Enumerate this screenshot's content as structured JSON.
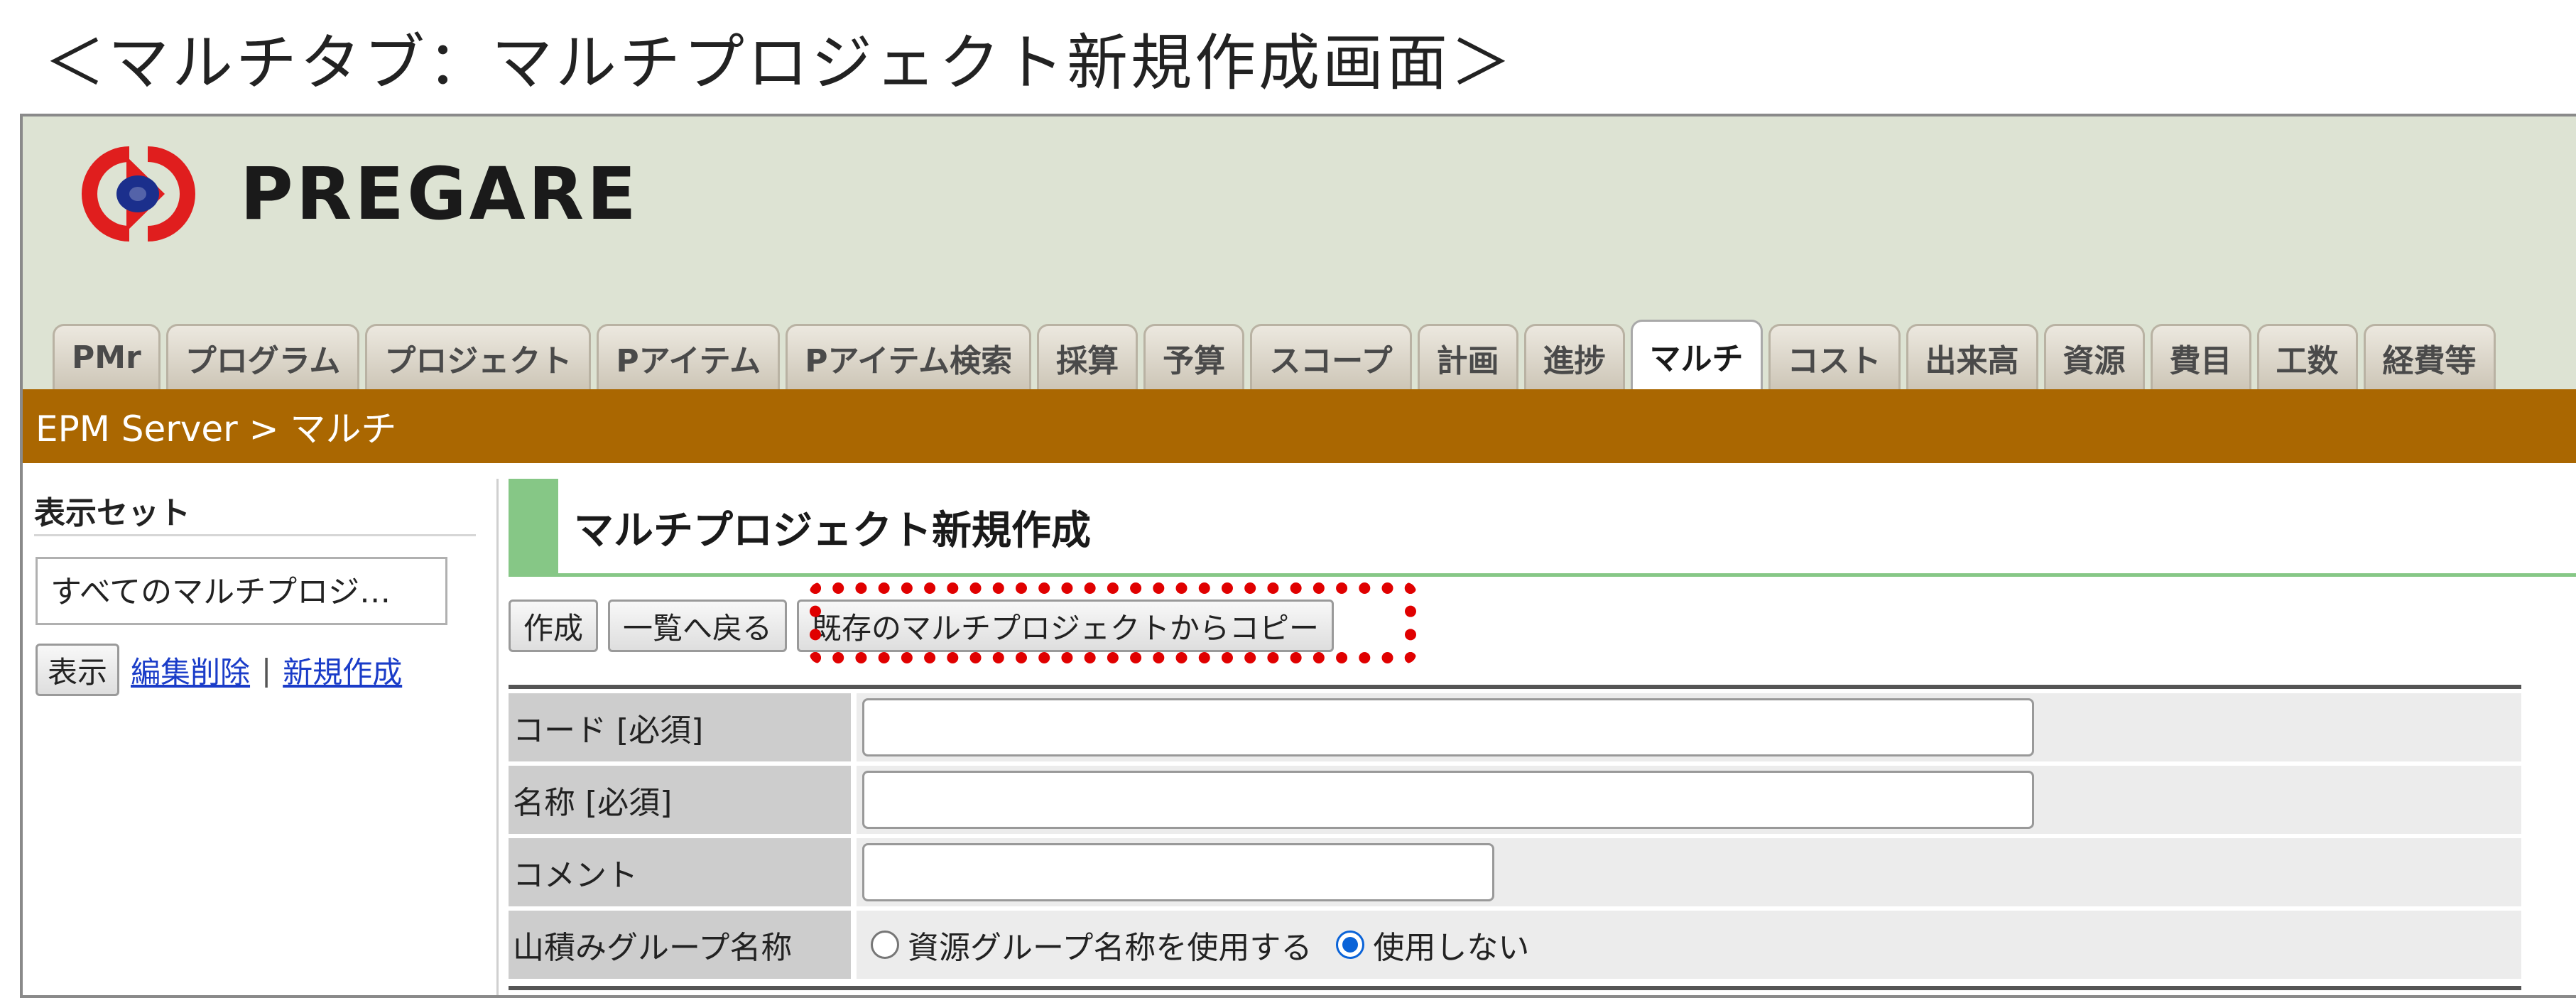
{
  "doc_title": "＜マルチタブ：マルチプロジェクト新規作成画面＞",
  "logo": {
    "text": "PREGARE",
    "icon": "pregare-logo-icon",
    "colors": {
      "red": "#e01e1e",
      "blue": "#1b2f8c"
    }
  },
  "tabs": [
    {
      "label": "PMr",
      "active": false
    },
    {
      "label": "プログラム",
      "active": false
    },
    {
      "label": "プロジェクト",
      "active": false
    },
    {
      "label": "Pアイテム",
      "active": false
    },
    {
      "label": "Pアイテム検索",
      "active": false
    },
    {
      "label": "採算",
      "active": false
    },
    {
      "label": "予算",
      "active": false
    },
    {
      "label": "スコープ",
      "active": false
    },
    {
      "label": "計画",
      "active": false
    },
    {
      "label": "進捗",
      "active": false
    },
    {
      "label": "マルチ",
      "active": true
    },
    {
      "label": "コスト",
      "active": false
    },
    {
      "label": "出来高",
      "active": false
    },
    {
      "label": "資源",
      "active": false
    },
    {
      "label": "費目",
      "active": false
    },
    {
      "label": "工数",
      "active": false
    },
    {
      "label": "経費等",
      "active": false
    }
  ],
  "breadcrumb": "EPM Server > マルチ",
  "sidebar": {
    "title": "表示セット",
    "selected_set": "すべてのマルチプロジ…",
    "show_button": "表示",
    "edit_delete_link": "編集削除",
    "separator": "|",
    "new_link": "新規作成"
  },
  "main": {
    "page_title": "マルチプロジェクト新規作成",
    "toolbar": {
      "create_label": "作成",
      "back_label": "一覧へ戻る",
      "copy_label": "既存のマルチプロジェクトからコピー"
    },
    "form": {
      "code_label": "コード [必須]",
      "code_value": "",
      "name_label": "名称 [必須]",
      "name_value": "",
      "comment_label": "コメント",
      "comment_value": "",
      "group_label": "山積みグループ名称",
      "group_options": [
        {
          "label": "資源グループ名称を使用する",
          "checked": false
        },
        {
          "label": "使用しない",
          "checked": true
        }
      ]
    }
  },
  "colors": {
    "header_bg": "#dde3d3",
    "breadcrumb_bar": "#aa6701",
    "title_accent": "#86c786",
    "highlight": "#e00000",
    "link": "#1a3cc8"
  }
}
